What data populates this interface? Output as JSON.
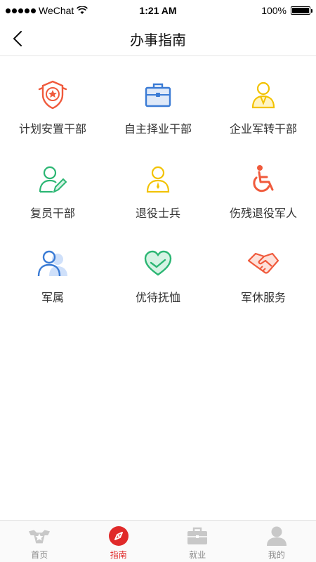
{
  "status_bar": {
    "carrier": "WeChat",
    "time": "1:21 AM",
    "battery": "100%",
    "battery_level": 1.0
  },
  "nav": {
    "title": "办事指南"
  },
  "grid": {
    "items": [
      {
        "label": "计划安置干部",
        "icon": "medal-star-icon",
        "color": "#f05a3c"
      },
      {
        "label": "自主择业干部",
        "icon": "briefcase-icon",
        "color": "#3a7bd5"
      },
      {
        "label": "企业军转干部",
        "icon": "officer-person-icon",
        "color": "#f2c200"
      },
      {
        "label": "复员干部",
        "icon": "person-edit-icon",
        "color": "#2bb673"
      },
      {
        "label": "退役士兵",
        "icon": "soldier-icon",
        "color": "#f2c200"
      },
      {
        "label": "伤残退役军人",
        "icon": "wheelchair-icon",
        "color": "#f05a3c"
      },
      {
        "label": "军属",
        "icon": "family-icon",
        "color": "#3a7bd5"
      },
      {
        "label": "优待抚恤",
        "icon": "heart-hands-icon",
        "color": "#2bb673"
      },
      {
        "label": "军休服务",
        "icon": "handshake-icon",
        "color": "#f05a3c"
      }
    ]
  },
  "tab_bar": {
    "tabs": [
      {
        "label": "首页",
        "icon": "home-star-icon",
        "active": false
      },
      {
        "label": "指南",
        "icon": "compass-icon",
        "active": true
      },
      {
        "label": "就业",
        "icon": "briefcase-icon",
        "active": false
      },
      {
        "label": "我的",
        "icon": "user-icon",
        "active": false
      }
    ]
  },
  "colors": {
    "accent": "#e02a2a",
    "inactive": "#c8c8c8"
  }
}
